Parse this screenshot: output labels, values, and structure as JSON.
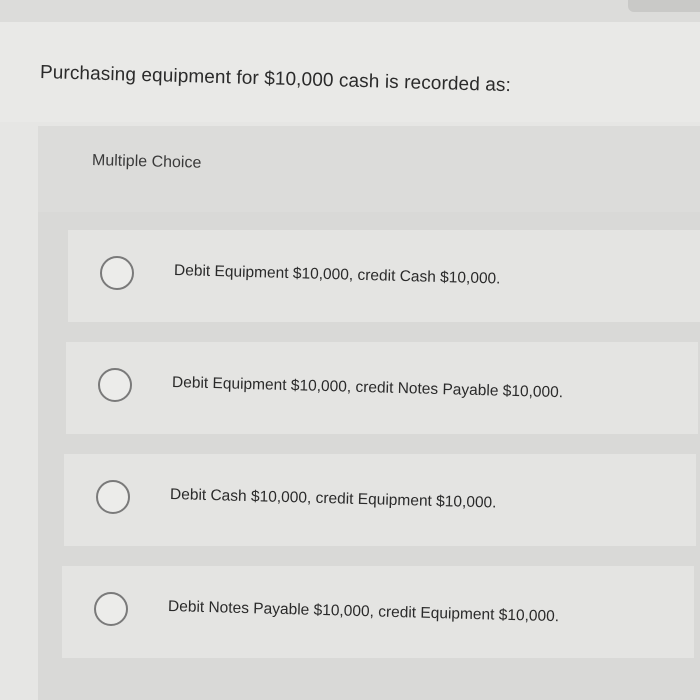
{
  "question": {
    "text": "Purchasing equipment for $10,000 cash is recorded as:"
  },
  "answer_section": {
    "label": "Multiple Choice",
    "options": [
      {
        "text": "Debit Equipment $10,000, credit Cash $10,000."
      },
      {
        "text": "Debit Equipment $10,000, credit Notes Payable $10,000."
      },
      {
        "text": "Debit Cash $10,000, credit Equipment $10,000."
      },
      {
        "text": "Debit Notes Payable $10,000, credit Equipment $10,000."
      }
    ]
  },
  "colors": {
    "background": "#e6e6e4",
    "option_background": "#e4e4e2",
    "radio_border": "#7a7a7a",
    "text": "#2a2a2a"
  }
}
